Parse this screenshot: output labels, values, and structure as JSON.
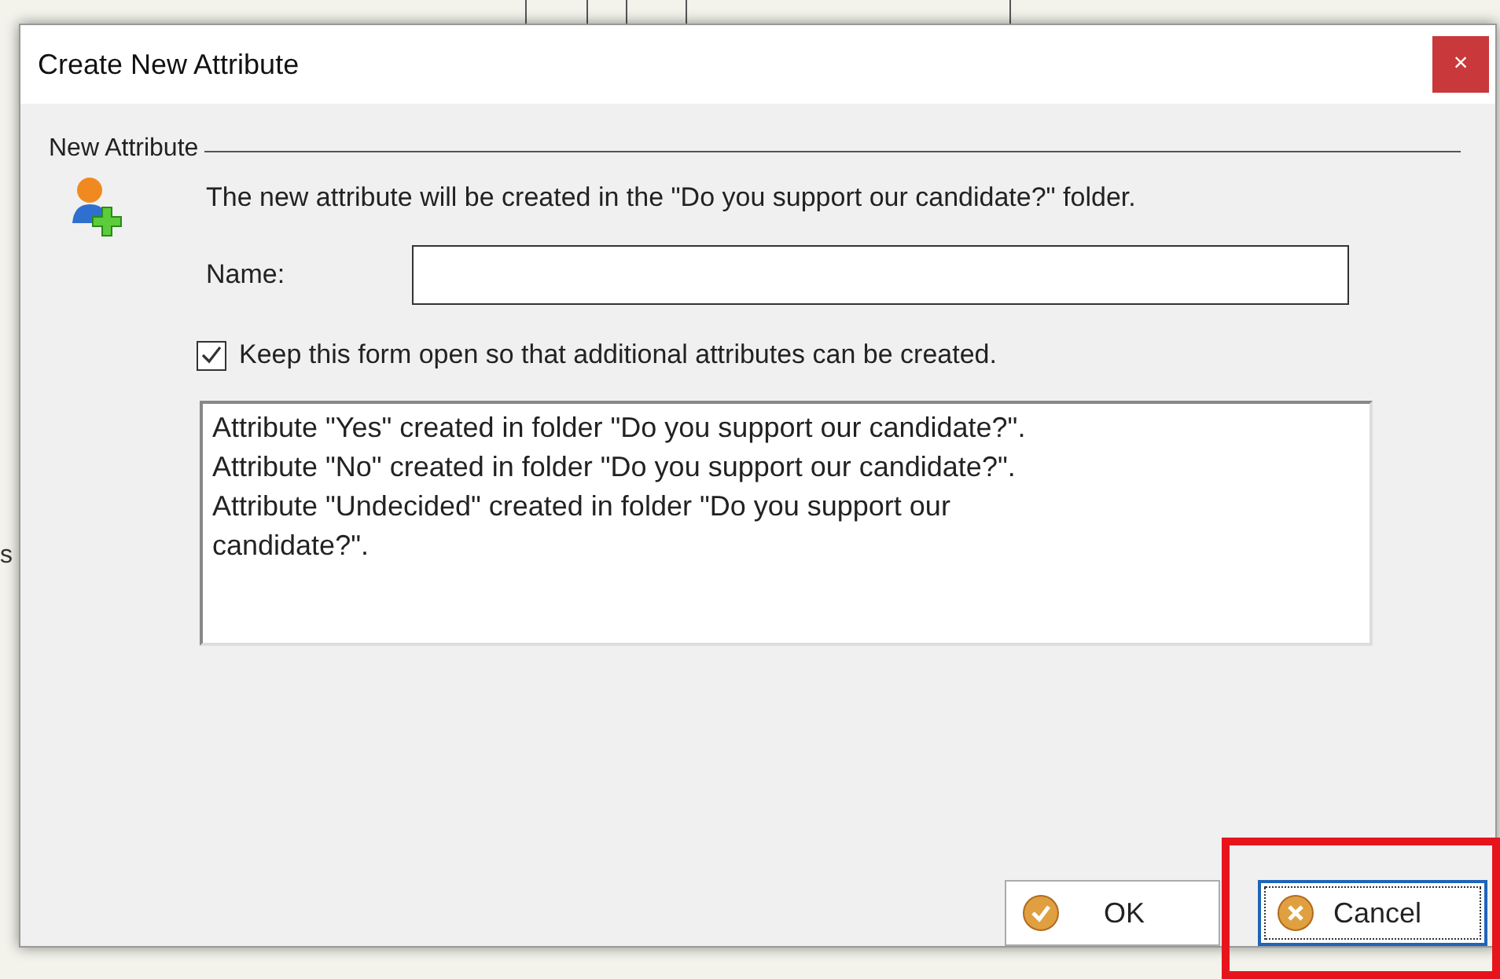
{
  "background_text": "s",
  "window": {
    "title": "Create New Attribute",
    "close": "×"
  },
  "group": {
    "label": "New Attribute"
  },
  "message": "The new attribute will be created in the \"Do you support our candidate?\" folder.",
  "name_field": {
    "label": "Name:"
  },
  "keep_open": {
    "label": "Keep this form open so that additional attributes can be created.",
    "checked": true
  },
  "log_lines": [
    "Attribute \"Yes\" created in folder \"Do you support our candidate?\".",
    "Attribute \"No\" created in folder \"Do you support our candidate?\".",
    "Attribute \"Undecided\" created in folder \"Do you support our",
    "candidate?\"."
  ],
  "buttons": [
    {
      "label": "OK",
      "kind": "ok",
      "focused": false
    },
    {
      "label": "Cancel",
      "kind": "cancel",
      "focused": true
    }
  ]
}
